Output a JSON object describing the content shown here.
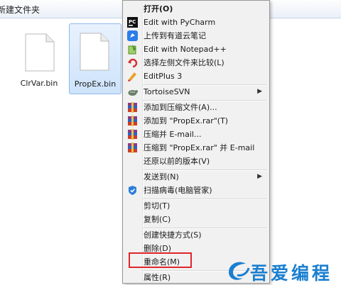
{
  "window": {
    "title": "新建文件夹"
  },
  "files": [
    {
      "name": "ClrVar.bin",
      "selected": false
    },
    {
      "name": "PropEx.bin",
      "selected": true
    }
  ],
  "context_menu": {
    "items": [
      {
        "label": "打开(O)",
        "icon": "open",
        "bold": true
      },
      {
        "label": "Edit with PyCharm",
        "icon": "pycharm-icon"
      },
      {
        "label": "上传到有道云笔记",
        "icon": "youdao-icon"
      },
      {
        "label": "Edit with Notepad++",
        "icon": "notepadpp-icon"
      },
      {
        "label": "选择左侧文件来比较(L)",
        "icon": "compare-icon"
      },
      {
        "label": "EditPlus 3",
        "icon": "editplus-icon"
      },
      {
        "label": "TortoiseSVN",
        "icon": "tortoisesvn-icon",
        "submenu": true
      },
      {
        "label": "添加到压缩文件(A)...",
        "icon": "winrar-icon"
      },
      {
        "label": "添加到 \"PropEx.rar\"(T)",
        "icon": "winrar-icon"
      },
      {
        "label": "压缩并 E-mail...",
        "icon": "winrar-icon"
      },
      {
        "label": "压缩到 \"PropEx.rar\" 并 E-mail",
        "icon": "winrar-icon"
      },
      {
        "label": "还原以前的版本(V)",
        "icon": ""
      },
      {
        "label": "发送到(N)",
        "icon": "",
        "submenu": true
      },
      {
        "label": "扫描病毒(电脑管家)",
        "icon": "shield-icon"
      },
      {
        "label": "剪切(T)",
        "icon": ""
      },
      {
        "label": "复制(C)",
        "icon": ""
      },
      {
        "label": "创建快捷方式(S)",
        "icon": ""
      },
      {
        "label": "删除(D)",
        "icon": ""
      },
      {
        "label": "重命名(M)",
        "icon": "",
        "highlighted": true
      },
      {
        "label": "属性(R)",
        "icon": ""
      }
    ]
  },
  "watermark": {
    "text": "吾爱编程"
  },
  "colors": {
    "highlight_border": "#e0262b",
    "watermark": "#1b7fd0",
    "selection": "#cde3fb"
  }
}
